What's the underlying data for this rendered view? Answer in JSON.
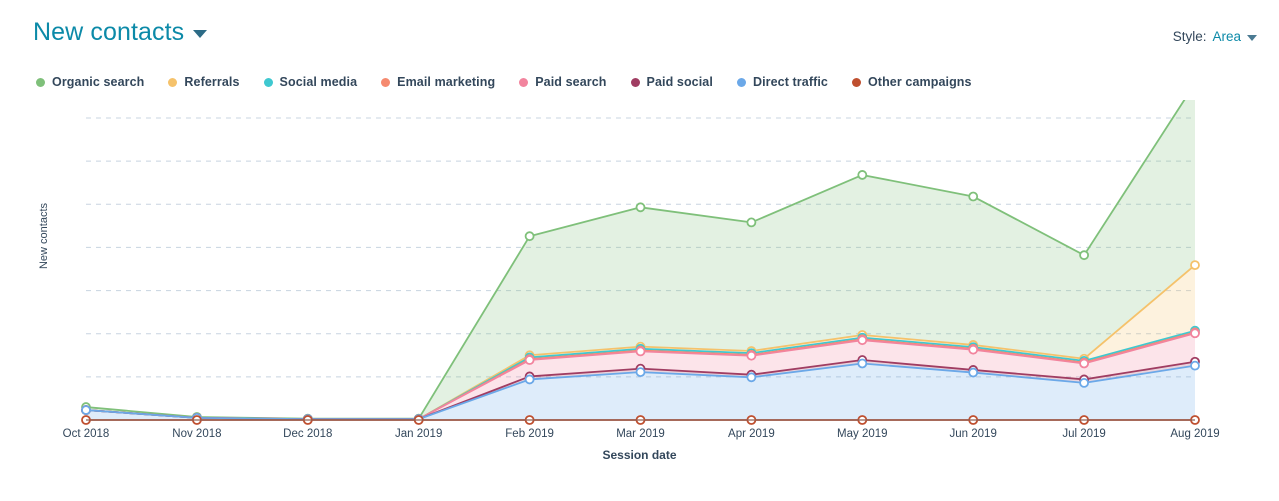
{
  "header": {
    "title": "New contacts",
    "title_caret_icon": "chevron-down-icon",
    "style_label": "Style:",
    "style_value": "Area",
    "style_caret_icon": "chevron-down-icon"
  },
  "legend": [
    {
      "label": "Organic search",
      "color": "#7fc07a"
    },
    {
      "label": "Referrals",
      "color": "#f5c26b"
    },
    {
      "label": "Social media",
      "color": "#3fc8d0"
    },
    {
      "label": "Email marketing",
      "color": "#f58a6f"
    },
    {
      "label": "Paid search",
      "color": "#f2849e"
    },
    {
      "label": "Paid social",
      "color": "#a03d62"
    },
    {
      "label": "Direct traffic",
      "color": "#6ba8e8"
    },
    {
      "label": "Other campaigns",
      "color": "#bf4f2f"
    }
  ],
  "chart_data": {
    "type": "area",
    "title": "New contacts",
    "xlabel": "Session date",
    "ylabel": "New contacts",
    "stacked": true,
    "grid": true,
    "legend_position": "top-left",
    "y_tick_labels_visible": false,
    "ylim": [
      0,
      7
    ],
    "gridline_count": 7,
    "categories": [
      "Oct 2018",
      "Nov 2018",
      "Dec 2018",
      "Jan 2019",
      "Feb 2019",
      "Mar 2019",
      "Apr 2019",
      "May 2019",
      "Jun 2019",
      "Jul 2019",
      "Aug 2019"
    ],
    "series": [
      {
        "name": "Other campaigns",
        "color": "#bf4f2f",
        "values": [
          0,
          0,
          0,
          0,
          0,
          0,
          0,
          0,
          0,
          0,
          0
        ]
      },
      {
        "name": "Direct traffic",
        "color": "#6ba8e8",
        "values": [
          0.23,
          0.05,
          0.02,
          0.02,
          0.94,
          1.11,
          0.99,
          1.31,
          1.1,
          0.86,
          1.26
        ]
      },
      {
        "name": "Paid social",
        "color": "#a03d62",
        "values": [
          0,
          0,
          0,
          0,
          0.07,
          0.08,
          0.06,
          0.08,
          0.06,
          0.08,
          0.09
        ]
      },
      {
        "name": "Paid search",
        "color": "#f2849e",
        "values": [
          0,
          0,
          0,
          0,
          0.38,
          0.4,
          0.44,
          0.46,
          0.47,
          0.37,
          0.66
        ]
      },
      {
        "name": "Email marketing",
        "color": "#f58a6f",
        "values": [
          0,
          0,
          0,
          0,
          0.02,
          0.02,
          0.02,
          0.02,
          0.02,
          0.02,
          0.02
        ]
      },
      {
        "name": "Social media",
        "color": "#3fc8d0",
        "values": [
          0,
          0,
          0,
          0,
          0.04,
          0.04,
          0.04,
          0.04,
          0.04,
          0.04,
          0.04
        ]
      },
      {
        "name": "Referrals",
        "color": "#f5c26b",
        "values": [
          0,
          0,
          0,
          0,
          0.05,
          0.05,
          0.05,
          0.06,
          0.05,
          0.05,
          1.52
        ]
      },
      {
        "name": "Organic search",
        "color": "#7fc07a",
        "values": [
          0.07,
          0.02,
          0.01,
          0.01,
          2.76,
          3.23,
          2.98,
          3.71,
          3.44,
          2.4,
          4.21
        ]
      }
    ]
  }
}
